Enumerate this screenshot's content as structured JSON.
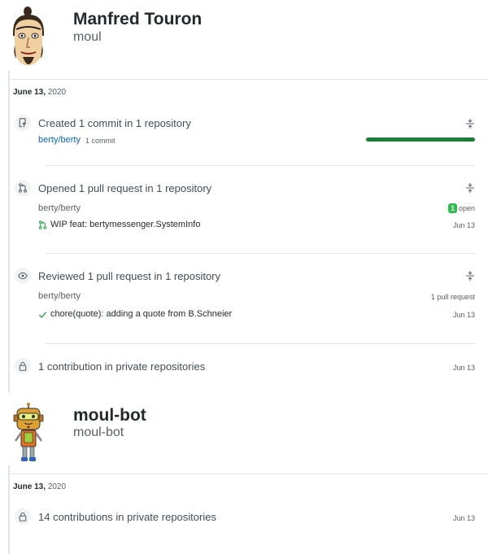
{
  "users": [
    {
      "name": "Manfred Touron",
      "login": "moul",
      "avatar_icon": "cartoon-face-avatar-icon",
      "date": {
        "month_day": "June 13,",
        "year": "2020"
      },
      "activities": [
        {
          "icon": "repo-push-icon",
          "heading": "Created 1 commit in 1 repository",
          "repo": "berty/berty",
          "detail": "1 commit",
          "progress": 1.0
        },
        {
          "icon": "git-pull-request-icon",
          "heading": "Opened 1 pull request in 1 repository",
          "repo": "berty/berty",
          "badge_count": "1",
          "badge_label": "open",
          "item": "WIP feat: bertymessenger.SystemInfo",
          "item_date": "Jun 13"
        },
        {
          "icon": "eye-icon",
          "heading": "Reviewed 1 pull request in 1 repository",
          "repo": "berty/berty",
          "right_label": "1 pull request",
          "item": "chore(quote): adding a quote from B.Schneier",
          "item_date": "Jun 13"
        },
        {
          "icon": "lock-icon",
          "heading": "1 contribution in private repositories",
          "item_date": "Jun 13"
        }
      ]
    },
    {
      "name": "moul-bot",
      "login": "moul-bot",
      "avatar_icon": "robot-avatar-icon",
      "date": {
        "month_day": "June 13,",
        "year": "2020"
      },
      "activities": [
        {
          "icon": "lock-icon",
          "heading": "14 contributions in private repositories",
          "item_date": "Jun 13"
        }
      ]
    }
  ],
  "colors": {
    "progress": "#1a7f37",
    "open_badge": "#2cbe4e",
    "link": "#0366d6",
    "check": "#28a745"
  }
}
